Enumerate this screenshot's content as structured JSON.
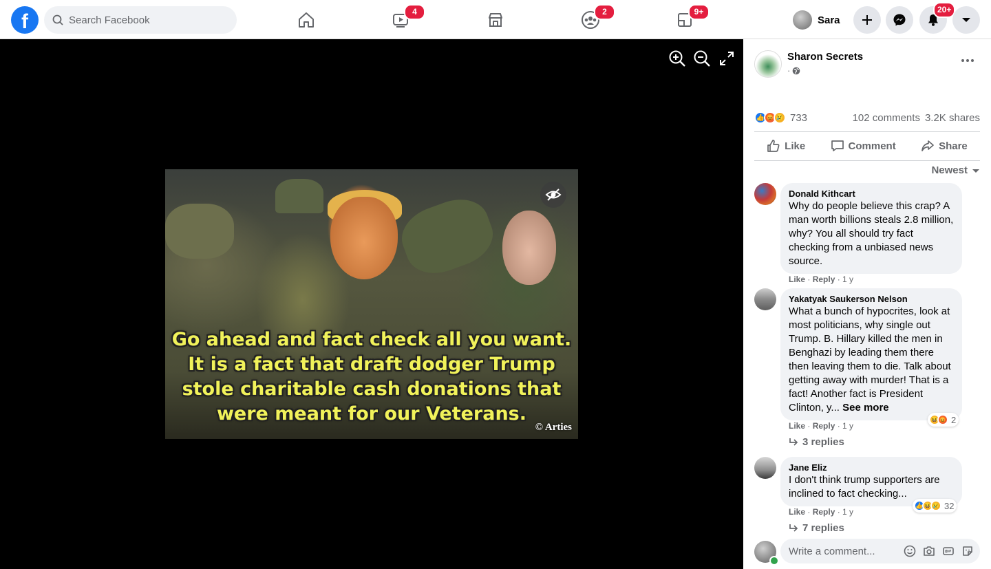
{
  "topbar": {
    "search_placeholder": "Search Facebook",
    "nav": [
      {
        "name": "home",
        "badge": ""
      },
      {
        "name": "watch",
        "badge": "4"
      },
      {
        "name": "marketplace",
        "badge": ""
      },
      {
        "name": "groups",
        "badge": "2"
      },
      {
        "name": "gaming",
        "badge": "9+"
      }
    ],
    "user_name": "Sara",
    "notifications_badge": "20+",
    "brand_color": "#1877f2",
    "badge_color": "#e41e3f"
  },
  "photo": {
    "caption_lines": [
      "Go ahead and fact check all you want.",
      "It is a fact that draft dodger Trump",
      "stole charitable cash donations that",
      "were meant for our Veterans."
    ],
    "credit": "© Arties"
  },
  "post": {
    "page_name": "Sharon Secrets",
    "meta": "·",
    "reaction_count": "733",
    "comments": "102 comments",
    "shares": "3.2K shares",
    "actions": {
      "like": "Like",
      "comment": "Comment",
      "share": "Share"
    },
    "sort_label": "Newest"
  },
  "comments": [
    {
      "author": "Donald Kithcart",
      "text": "Why do people believe this crap? A man worth billions steals 2.8 million, why? You all should try fact checking from a unbiased news source.",
      "see_more": "",
      "like": "Like",
      "reply": "Reply",
      "time": "1 y",
      "reaction_count": "",
      "replies": ""
    },
    {
      "author": "Yakatyak Saukerson Nelson",
      "text": "What a bunch of hypocrites, look at most politicians, why single out Trump. B. Hillary killed the men in Benghazi by leading them there then leaving them to die. Talk about getting away with murder! That is a fact! Another fact is President Clinton, y...",
      "see_more": "See more",
      "like": "Like",
      "reply": "Reply",
      "time": "1 y",
      "reaction_count": "2",
      "replies": "3 replies"
    },
    {
      "author": "Jane Eliz",
      "text": "I don't think trump supporters are inclined to fact checking...",
      "see_more": "",
      "like": "Like",
      "reply": "Reply",
      "time": "1 y",
      "reaction_count": "32",
      "replies": "7 replies"
    }
  ],
  "composer": {
    "placeholder": "Write a comment..."
  }
}
